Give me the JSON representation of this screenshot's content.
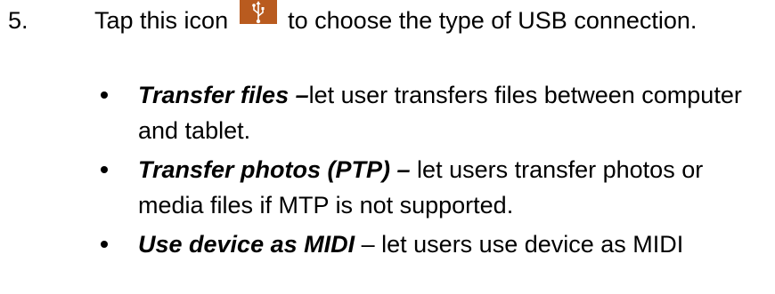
{
  "step": {
    "number": "5.",
    "text_before_icon": "Tap this icon",
    "icon": "usb-icon",
    "icon_color": "#b95b1f",
    "text_after_icon": "to choose the type of USB connection."
  },
  "options": [
    {
      "term": "Transfer files –",
      "description": "let user transfers files between computer and tablet."
    },
    {
      "term": "Transfer photos (PTP) –",
      "description": " let users transfer photos or media files if MTP is not supported."
    },
    {
      "term": "Use device as MIDI",
      "description": " – let users use device as MIDI"
    }
  ]
}
